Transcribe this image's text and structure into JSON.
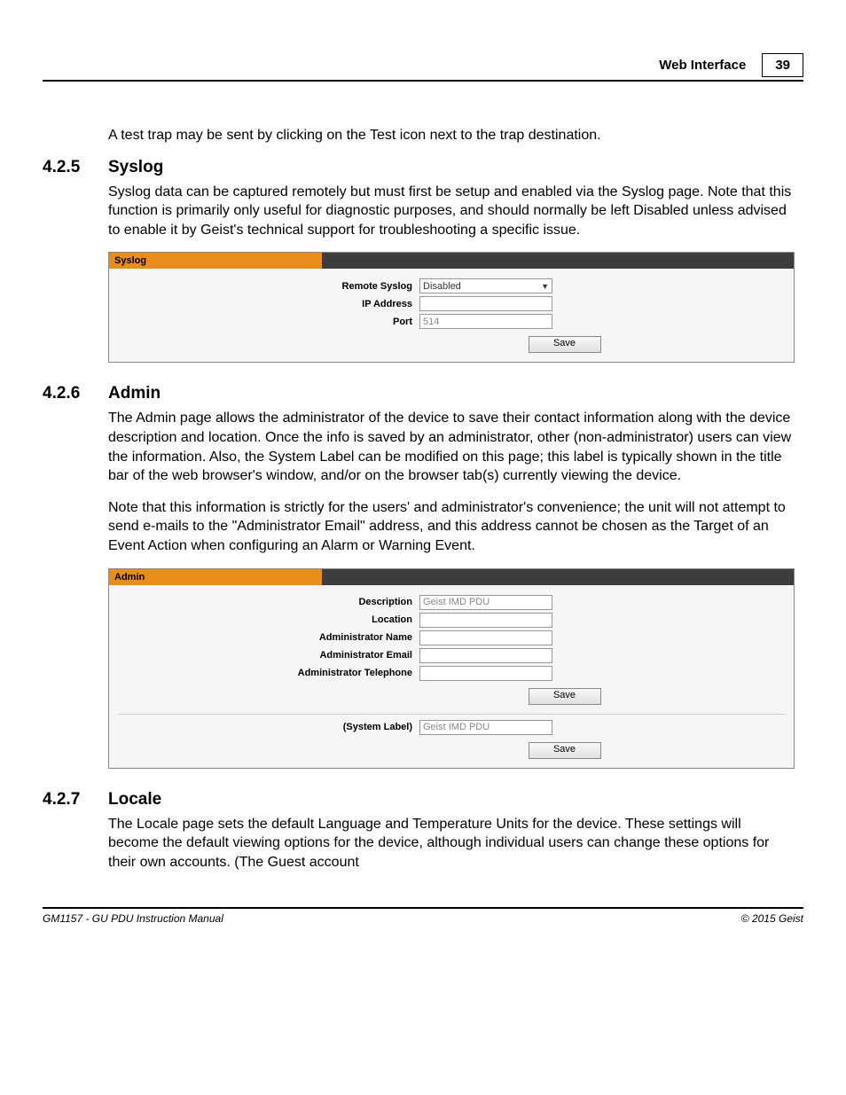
{
  "header": {
    "title": "Web Interface",
    "page": "39"
  },
  "intro_text": "A test trap may be sent by clicking on the Test icon next to the trap destination.",
  "sections": {
    "syslog": {
      "num": "4.2.5",
      "title": "Syslog",
      "para": "Syslog data can be captured remotely but must first be setup and enabled via the Syslog page.  Note that this function is primarily only useful for diagnostic purposes, and should normally be left Disabled unless advised to enable it by Geist's technical support for troubleshooting a specific issue.",
      "panel_title": "Syslog",
      "fields": {
        "remote_label": "Remote Syslog",
        "remote_value": "Disabled",
        "ip_label": "IP Address",
        "ip_value": "",
        "port_label": "Port",
        "port_value": "514"
      },
      "save": "Save"
    },
    "admin": {
      "num": "4.2.6",
      "title": "Admin",
      "para1": "The Admin page allows the administrator of the device to save their contact information along with the device description and location. Once the info is saved by an administrator, other (non-administrator) users can view the information. Also, the System Label can be modified on this page; this label is typically shown in the title bar of the web browser's window, and/or on the browser tab(s) currently viewing the device.",
      "para2": "Note that this information is strictly for the users' and administrator's convenience; the unit will not attempt to send e-mails to the \"Administrator Email\" address, and this address cannot be chosen as the Target of an Event Action when configuring an Alarm or Warning Event.",
      "panel_title": "Admin",
      "fields": {
        "desc_label": "Description",
        "desc_value": "Geist IMD PDU",
        "loc_label": "Location",
        "loc_value": "",
        "name_label": "Administrator Name",
        "name_value": "",
        "email_label": "Administrator Email",
        "email_value": "",
        "tel_label": "Administrator Telephone",
        "tel_value": "",
        "syslabel_label": "(System Label)",
        "syslabel_value": "Geist IMD PDU"
      },
      "save": "Save"
    },
    "locale": {
      "num": "4.2.7",
      "title": "Locale",
      "para": "The Locale page sets the default Language and Temperature Units for the device. These settings will become the default viewing options for the device, although individual users can change these options for their own accounts.  (The Guest account"
    }
  },
  "footer": {
    "left": "GM1157 - GU PDU Instruction Manual",
    "right": "© 2015 Geist"
  }
}
